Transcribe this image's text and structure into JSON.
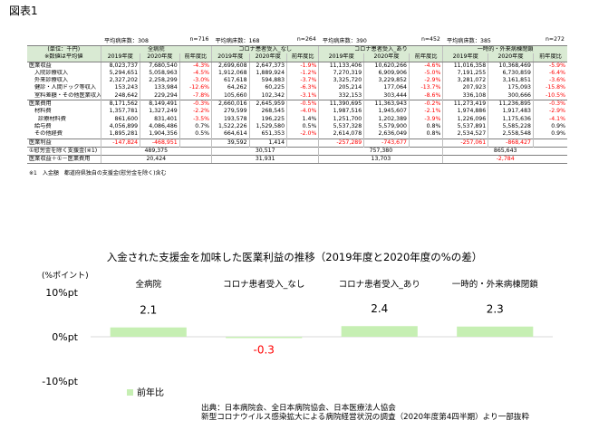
{
  "figure_title": "図表1",
  "table": {
    "meta": [
      {
        "label": "平均病床数：308",
        "count": "n=716"
      },
      {
        "label": "平均病床数：168",
        "count": "n=264"
      },
      {
        "label": "平均病床数：390",
        "count": "n=452"
      },
      {
        "label": "平均病床数：385",
        "count": "n=272"
      }
    ],
    "header_corner": [
      "(単位：千円)",
      "※数値は平均値"
    ],
    "groups": [
      "全病院",
      "コロナ患者受入_なし",
      "コロナ患者受入_あり",
      "一時的・外来病棟閉鎖"
    ],
    "subheaders": [
      "2019年度",
      "2020年度",
      "前年度比"
    ],
    "rows": [
      {
        "label": "医業収益",
        "cells": [
          "8,023,737",
          "7,680,540",
          "-4.3%",
          "2,699,608",
          "2,647,373",
          "-1.9%",
          "11,133,406",
          "10,620,266",
          "-4.6%",
          "11,016,358",
          "10,368,469",
          "-5.9%"
        ]
      },
      {
        "label": "入院診療収入",
        "cells": [
          "5,294,651",
          "5,058,963",
          "-4.5%",
          "1,912,068",
          "1,889,924",
          "-1.2%",
          "7,270,319",
          "6,909,906",
          "-5.0%",
          "7,191,255",
          "6,730,859",
          "-6.4%"
        ]
      },
      {
        "label": "外来診療収入",
        "cells": [
          "2,327,202",
          "2,258,299",
          "-3.0%",
          "617,618",
          "594,883",
          "-3.7%",
          "3,325,720",
          "3,229,852",
          "-2.9%",
          "3,281,072",
          "3,161,851",
          "-3.6%"
        ]
      },
      {
        "label": "健診・人間ドック等収入",
        "cells": [
          "153,243",
          "133,984",
          "-12.6%",
          "64,262",
          "60,225",
          "-6.3%",
          "205,214",
          "177,064",
          "-13.7%",
          "207,923",
          "175,093",
          "-15.8%"
        ]
      },
      {
        "label": "室料差額・その他医業収入",
        "cells": [
          "248,642",
          "229,294",
          "-7.8%",
          "105,660",
          "102,342",
          "-3.1%",
          "332,153",
          "303,444",
          "-8.6%",
          "336,108",
          "300,666",
          "-10.5%"
        ]
      },
      {
        "label": "医業費用",
        "cells": [
          "8,171,562",
          "8,149,491",
          "-0.3%",
          "2,660,016",
          "2,645,959",
          "-0.5%",
          "11,390,695",
          "11,363,943",
          "-0.2%",
          "11,273,419",
          "11,236,895",
          "-0.3%"
        ]
      },
      {
        "label": "材料費",
        "cells": [
          "1,357,781",
          "1,327,249",
          "-2.2%",
          "279,599",
          "268,545",
          "-4.0%",
          "1,987,516",
          "1,945,607",
          "-2.1%",
          "1,974,886",
          "1,917,483",
          "-2.9%"
        ]
      },
      {
        "label": "診療材料費",
        "cells": [
          "861,600",
          "831,401",
          "-3.5%",
          "193,578",
          "196,225",
          "1.4%",
          "1,251,700",
          "1,202,389",
          "-3.9%",
          "1,226,096",
          "1,175,636",
          "-4.1%"
        ]
      },
      {
        "label": "給与費",
        "cells": [
          "4,056,899",
          "4,086,486",
          "0.7%",
          "1,522,226",
          "1,529,580",
          "0.5%",
          "5,537,328",
          "5,579,900",
          "0.8%",
          "5,537,891",
          "5,585,228",
          "0.9%"
        ]
      },
      {
        "label": "その他経費",
        "cells": [
          "1,895,281",
          "1,904,356",
          "0.5%",
          "664,614",
          "651,353",
          "-2.0%",
          "2,614,078",
          "2,636,049",
          "0.8%",
          "2,534,527",
          "2,558,548",
          "0.9%"
        ]
      },
      {
        "label": "医業利益",
        "cells": [
          "-147,824",
          "-468,951",
          "",
          "39,592",
          "1,414",
          "",
          "-257,289",
          "-743,677",
          "",
          "-257,061",
          "-868,427",
          ""
        ]
      }
    ],
    "merged_rows": [
      {
        "label": "①慰労金を除く支援金(※1)",
        "values": [
          "489,375",
          "30,517",
          "757,380",
          "865,643"
        ]
      },
      {
        "label": "医業収益＋①－医業費用",
        "values": [
          "20,424",
          "31,931",
          "13,703",
          "-2,784"
        ]
      }
    ],
    "footnote": "※1　入金額　都道府県独自の支援金(慰労金を除く)含む"
  },
  "chart_data": {
    "type": "bar",
    "title": "入金された支援金を加味した医業利益の推移（2019年度と2020年度の%の差）",
    "ylabel": "(%ポイント)",
    "categories": [
      "全病院",
      "コロナ患者受入_なし",
      "コロナ患者受入_あり",
      "一時的・外来病棟閉鎖"
    ],
    "series": [
      {
        "name": "前年比",
        "values": [
          2.1,
          -0.3,
          2.4,
          2.3
        ]
      }
    ],
    "value_labels": [
      "2.1",
      "-0.3",
      "2.4",
      "2.3"
    ],
    "ytick_labels": [
      "10%pt",
      "0%pt",
      "-10%pt"
    ],
    "ylim": [
      -10,
      10
    ],
    "colors": {
      "bar": "#c6efb3",
      "negative_label": "#ff0000"
    },
    "legend_position": "bottom-left",
    "grid": false
  },
  "source": {
    "prefix": "出典：",
    "line1": "日本病院会、全日本病院協会、日本医療法人協会",
    "line2": "新型コロナウイルス感染拡大による病院経営状況の調査（2020年度第4四半期）より一部抜粋"
  }
}
